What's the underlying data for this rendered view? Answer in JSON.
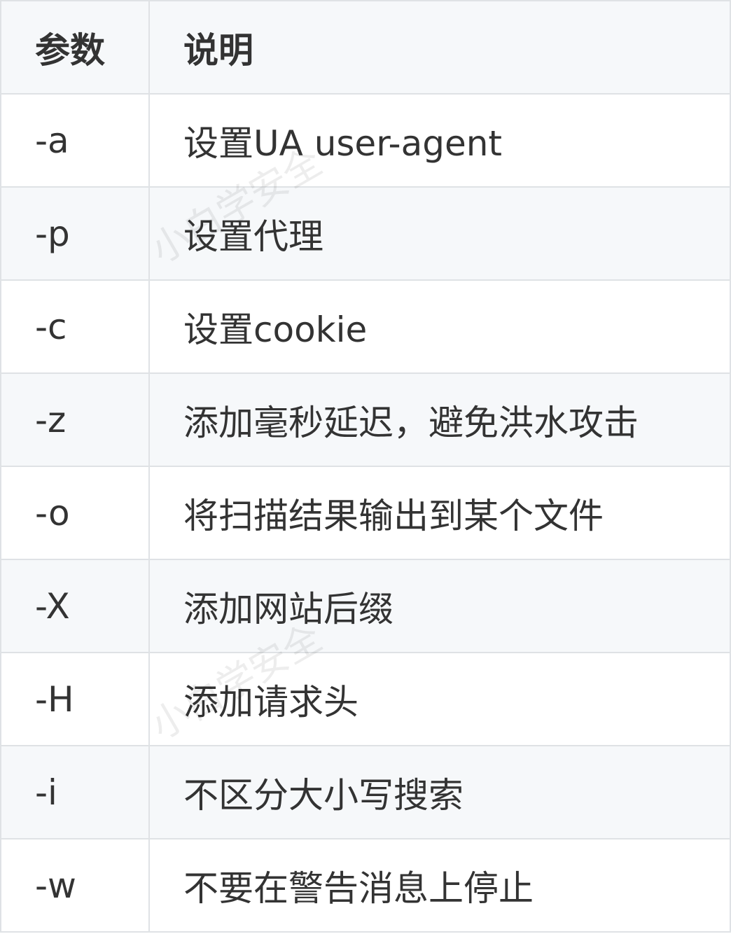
{
  "table": {
    "headers": [
      "参数",
      "说明"
    ],
    "rows": [
      {
        "param": "-a",
        "desc": "设置UA user-agent"
      },
      {
        "param": "-p",
        "desc": "设置代理"
      },
      {
        "param": "-c",
        "desc": "设置cookie"
      },
      {
        "param": "-z",
        "desc": "添加毫秒延迟，避免洪水攻击"
      },
      {
        "param": "-o",
        "desc": "将扫描结果输出到某个文件"
      },
      {
        "param": "-X",
        "desc": "添加网站后缀"
      },
      {
        "param": "-H",
        "desc": "添加请求头"
      },
      {
        "param": "-i",
        "desc": "不区分大小写搜索"
      },
      {
        "param": "-w",
        "desc": "不要在警告消息上停止"
      }
    ]
  },
  "watermark": {
    "text": "小白学安全"
  },
  "colors": {
    "border": "#dfe2e5",
    "stripe": "#f6f8fa",
    "text": "#333333"
  }
}
